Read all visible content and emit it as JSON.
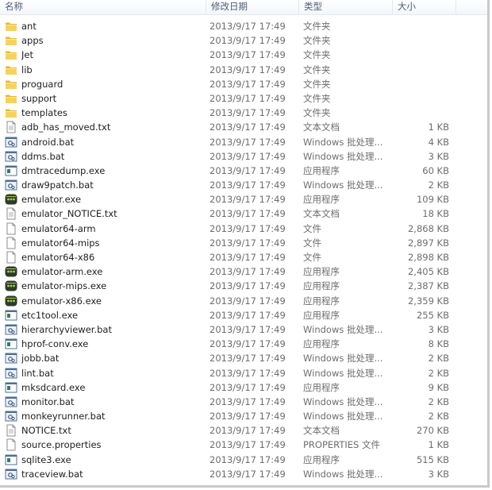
{
  "columns": {
    "name": "名称",
    "date": "修改日期",
    "type": "类型",
    "size": "大小"
  },
  "files": [
    {
      "name": "ant",
      "date": "2013/9/17 17:49",
      "type": "文件夹",
      "size": "",
      "icon": "folder-icon"
    },
    {
      "name": "apps",
      "date": "2013/9/17 17:49",
      "type": "文件夹",
      "size": "",
      "icon": "folder-icon"
    },
    {
      "name": "Jet",
      "date": "2013/9/17 17:49",
      "type": "文件夹",
      "size": "",
      "icon": "folder-icon"
    },
    {
      "name": "lib",
      "date": "2013/9/17 17:49",
      "type": "文件夹",
      "size": "",
      "icon": "folder-icon"
    },
    {
      "name": "proguard",
      "date": "2013/9/17 17:49",
      "type": "文件夹",
      "size": "",
      "icon": "folder-icon"
    },
    {
      "name": "support",
      "date": "2013/9/17 17:49",
      "type": "文件夹",
      "size": "",
      "icon": "folder-icon"
    },
    {
      "name": "templates",
      "date": "2013/9/17 17:49",
      "type": "文件夹",
      "size": "",
      "icon": "folder-icon"
    },
    {
      "name": "adb_has_moved.txt",
      "date": "2013/9/17 17:49",
      "type": "文本文档",
      "size": "1 KB",
      "icon": "text-file-icon"
    },
    {
      "name": "android.bat",
      "date": "2013/9/17 17:49",
      "type": "Windows 批处理...",
      "size": "4 KB",
      "icon": "batch-file-icon"
    },
    {
      "name": "ddms.bat",
      "date": "2013/9/17 17:49",
      "type": "Windows 批处理...",
      "size": "3 KB",
      "icon": "batch-file-icon"
    },
    {
      "name": "dmtracedump.exe",
      "date": "2013/9/17 17:49",
      "type": "应用程序",
      "size": "60 KB",
      "icon": "executable-icon"
    },
    {
      "name": "draw9patch.bat",
      "date": "2013/9/17 17:49",
      "type": "Windows 批处理...",
      "size": "2 KB",
      "icon": "batch-file-icon"
    },
    {
      "name": "emulator.exe",
      "date": "2013/9/17 17:49",
      "type": "应用程序",
      "size": "109 KB",
      "icon": "emulator-icon"
    },
    {
      "name": "emulator_NOTICE.txt",
      "date": "2013/9/17 17:49",
      "type": "文本文档",
      "size": "18 KB",
      "icon": "text-file-icon"
    },
    {
      "name": "emulator64-arm",
      "date": "2013/9/17 17:49",
      "type": "文件",
      "size": "2,868 KB",
      "icon": "blank-file-icon"
    },
    {
      "name": "emulator64-mips",
      "date": "2013/9/17 17:49",
      "type": "文件",
      "size": "2,897 KB",
      "icon": "blank-file-icon"
    },
    {
      "name": "emulator64-x86",
      "date": "2013/9/17 17:49",
      "type": "文件",
      "size": "2,898 KB",
      "icon": "blank-file-icon"
    },
    {
      "name": "emulator-arm.exe",
      "date": "2013/9/17 17:49",
      "type": "应用程序",
      "size": "2,405 KB",
      "icon": "emulator-icon"
    },
    {
      "name": "emulator-mips.exe",
      "date": "2013/9/17 17:49",
      "type": "应用程序",
      "size": "2,387 KB",
      "icon": "emulator-icon"
    },
    {
      "name": "emulator-x86.exe",
      "date": "2013/9/17 17:49",
      "type": "应用程序",
      "size": "2,359 KB",
      "icon": "emulator-icon"
    },
    {
      "name": "etc1tool.exe",
      "date": "2013/9/17 17:49",
      "type": "应用程序",
      "size": "255 KB",
      "icon": "executable-icon"
    },
    {
      "name": "hierarchyviewer.bat",
      "date": "2013/9/17 17:49",
      "type": "Windows 批处理...",
      "size": "3 KB",
      "icon": "batch-file-icon"
    },
    {
      "name": "hprof-conv.exe",
      "date": "2013/9/17 17:49",
      "type": "应用程序",
      "size": "8 KB",
      "icon": "executable-icon"
    },
    {
      "name": "jobb.bat",
      "date": "2013/9/17 17:49",
      "type": "Windows 批处理...",
      "size": "2 KB",
      "icon": "batch-file-icon"
    },
    {
      "name": "lint.bat",
      "date": "2013/9/17 17:49",
      "type": "Windows 批处理...",
      "size": "2 KB",
      "icon": "batch-file-icon"
    },
    {
      "name": "mksdcard.exe",
      "date": "2013/9/17 17:49",
      "type": "应用程序",
      "size": "9 KB",
      "icon": "executable-icon"
    },
    {
      "name": "monitor.bat",
      "date": "2013/9/17 17:49",
      "type": "Windows 批处理...",
      "size": "2 KB",
      "icon": "batch-file-icon"
    },
    {
      "name": "monkeyrunner.bat",
      "date": "2013/9/17 17:49",
      "type": "Windows 批处理...",
      "size": "2 KB",
      "icon": "batch-file-icon"
    },
    {
      "name": "NOTICE.txt",
      "date": "2013/9/17 17:49",
      "type": "文本文档",
      "size": "270 KB",
      "icon": "text-file-icon"
    },
    {
      "name": "source.properties",
      "date": "2013/9/17 17:49",
      "type": "PROPERTIES 文件",
      "size": "1 KB",
      "icon": "blank-file-icon"
    },
    {
      "name": "sqlite3.exe",
      "date": "2013/9/17 17:49",
      "type": "应用程序",
      "size": "515 KB",
      "icon": "executable-icon"
    },
    {
      "name": "traceview.bat",
      "date": "2013/9/17 17:49",
      "type": "Windows 批处理...",
      "size": "3 KB",
      "icon": "batch-file-icon"
    }
  ]
}
